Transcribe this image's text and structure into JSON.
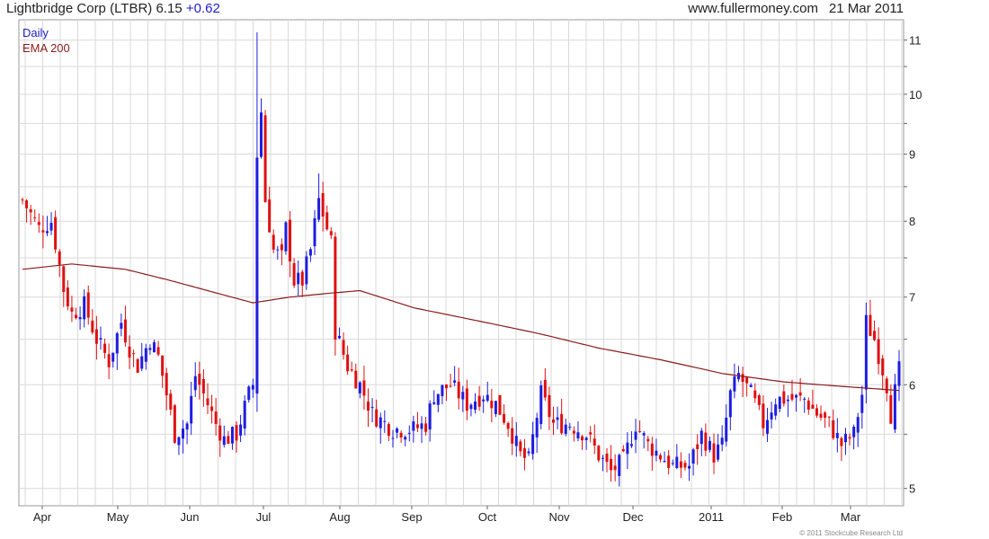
{
  "header": {
    "company": "Lightbridge Corp (LTBR)",
    "price": "6.15",
    "change": "+0.62",
    "site": "www.fullermoney.com",
    "date": "21 Mar 2011"
  },
  "legend": {
    "daily": "Daily",
    "ema": "EMA 200"
  },
  "copyright": "© 2011 Stockcube Research Ltd",
  "colors": {
    "up": "#1d1de0",
    "down": "#e01010",
    "ema": "#8b1a1a",
    "grid": "#d9d9d9",
    "legend_daily": "#1d1dc8",
    "legend_ema": "#8b1a1a"
  },
  "chart_data": {
    "type": "candlestick",
    "ylim": [
      4.85,
      11.4
    ],
    "yticks": [
      "5",
      "6",
      "7",
      "8",
      "9",
      "10",
      "11"
    ],
    "y_scale": "log",
    "months": [
      "Apr",
      "May",
      "Jun",
      "Jul",
      "Aug",
      "Sep",
      "Oct",
      "Nov",
      "Dec",
      "2011",
      "Feb",
      "Mar"
    ],
    "grid": true,
    "anchors": [
      {
        "d": 0,
        "v": 8.3
      },
      {
        "d": 2,
        "v": 8.1
      },
      {
        "d": 4,
        "v": 7.9
      },
      {
        "d": 7,
        "v": 8.0
      },
      {
        "d": 10,
        "v": 7.1
      },
      {
        "d": 12,
        "v": 6.8
      },
      {
        "d": 15,
        "v": 6.9
      },
      {
        "d": 18,
        "v": 6.5
      },
      {
        "d": 21,
        "v": 6.25
      },
      {
        "d": 24,
        "v": 6.7
      },
      {
        "d": 26,
        "v": 6.4
      },
      {
        "d": 28,
        "v": 6.2
      },
      {
        "d": 31,
        "v": 6.5
      },
      {
        "d": 33,
        "v": 6.3
      },
      {
        "d": 35,
        "v": 5.9
      },
      {
        "d": 37,
        "v": 5.5
      },
      {
        "d": 40,
        "v": 5.6
      },
      {
        "d": 42,
        "v": 6.1
      },
      {
        "d": 44,
        "v": 5.9
      },
      {
        "d": 47,
        "v": 5.6
      },
      {
        "d": 49,
        "v": 5.45
      },
      {
        "d": 52,
        "v": 5.5
      },
      {
        "d": 55,
        "v": 5.9
      },
      {
        "d": 56,
        "v": 6.0
      },
      {
        "d": 57,
        "v": 9.0
      },
      {
        "d": 58,
        "v": 9.7
      },
      {
        "d": 59,
        "v": 8.3
      },
      {
        "d": 61,
        "v": 7.6
      },
      {
        "d": 63,
        "v": 7.5
      },
      {
        "d": 64,
        "v": 7.9
      },
      {
        "d": 66,
        "v": 7.2
      },
      {
        "d": 68,
        "v": 7.2
      },
      {
        "d": 70,
        "v": 7.6
      },
      {
        "d": 72,
        "v": 8.3
      },
      {
        "d": 74,
        "v": 7.9
      },
      {
        "d": 75,
        "v": 7.7
      },
      {
        "d": 76,
        "v": 6.6
      },
      {
        "d": 79,
        "v": 6.2
      },
      {
        "d": 82,
        "v": 6.0
      },
      {
        "d": 85,
        "v": 5.7
      },
      {
        "d": 90,
        "v": 5.55
      },
      {
        "d": 95,
        "v": 5.55
      },
      {
        "d": 98,
        "v": 5.6
      },
      {
        "d": 100,
        "v": 5.9
      },
      {
        "d": 104,
        "v": 6.0
      },
      {
        "d": 108,
        "v": 5.8
      },
      {
        "d": 112,
        "v": 5.9
      },
      {
        "d": 115,
        "v": 5.8
      },
      {
        "d": 118,
        "v": 5.6
      },
      {
        "d": 121,
        "v": 5.3
      },
      {
        "d": 123,
        "v": 5.25
      },
      {
        "d": 126,
        "v": 5.9
      },
      {
        "d": 129,
        "v": 5.6
      },
      {
        "d": 133,
        "v": 5.6
      },
      {
        "d": 137,
        "v": 5.5
      },
      {
        "d": 140,
        "v": 5.3
      },
      {
        "d": 143,
        "v": 5.15
      },
      {
        "d": 146,
        "v": 5.25
      },
      {
        "d": 149,
        "v": 5.6
      },
      {
        "d": 152,
        "v": 5.4
      },
      {
        "d": 155,
        "v": 5.3
      },
      {
        "d": 158,
        "v": 5.2
      },
      {
        "d": 162,
        "v": 5.2
      },
      {
        "d": 165,
        "v": 5.5
      },
      {
        "d": 168,
        "v": 5.3
      },
      {
        "d": 170,
        "v": 5.4
      },
      {
        "d": 172,
        "v": 5.9
      },
      {
        "d": 174,
        "v": 6.1
      },
      {
        "d": 177,
        "v": 5.9
      },
      {
        "d": 180,
        "v": 5.6
      },
      {
        "d": 183,
        "v": 5.85
      },
      {
        "d": 187,
        "v": 5.85
      },
      {
        "d": 190,
        "v": 5.85
      },
      {
        "d": 193,
        "v": 5.7
      },
      {
        "d": 196,
        "v": 5.6
      },
      {
        "d": 199,
        "v": 5.4
      },
      {
        "d": 202,
        "v": 5.5
      },
      {
        "d": 204,
        "v": 5.9
      },
      {
        "d": 205,
        "v": 6.7
      },
      {
        "d": 207,
        "v": 6.5
      },
      {
        "d": 210,
        "v": 6.0
      },
      {
        "d": 211,
        "v": 5.7
      },
      {
        "d": 213,
        "v": 6.15
      }
    ],
    "ema": [
      {
        "d": 0,
        "v": 7.35
      },
      {
        "d": 12,
        "v": 7.42
      },
      {
        "d": 25,
        "v": 7.35
      },
      {
        "d": 35,
        "v": 7.22
      },
      {
        "d": 45,
        "v": 7.08
      },
      {
        "d": 56,
        "v": 6.93
      },
      {
        "d": 65,
        "v": 7.0
      },
      {
        "d": 75,
        "v": 7.05
      },
      {
        "d": 82,
        "v": 7.08
      },
      {
        "d": 95,
        "v": 6.87
      },
      {
        "d": 110,
        "v": 6.72
      },
      {
        "d": 125,
        "v": 6.57
      },
      {
        "d": 140,
        "v": 6.4
      },
      {
        "d": 155,
        "v": 6.27
      },
      {
        "d": 170,
        "v": 6.12
      },
      {
        "d": 185,
        "v": 6.03
      },
      {
        "d": 200,
        "v": 5.98
      },
      {
        "d": 213,
        "v": 5.94
      }
    ]
  }
}
